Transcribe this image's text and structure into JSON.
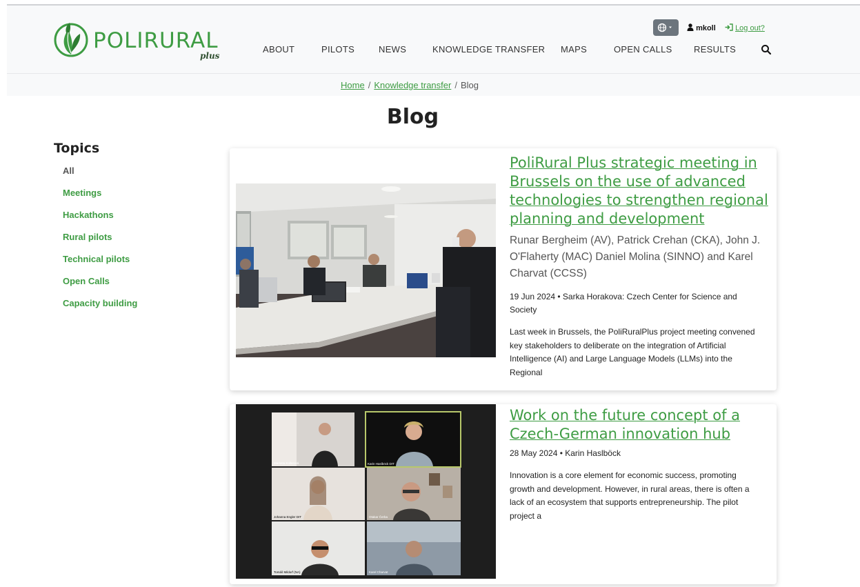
{
  "brand": {
    "name": "POLIRURAL",
    "suffix": "plus",
    "color": "#3e9c43"
  },
  "nav": {
    "items": [
      "ABOUT",
      "PILOTS",
      "NEWS",
      "KNOWLEDGE TRANSFER",
      "MAPS",
      "OPEN CALLS",
      "RESULTS"
    ],
    "search_icon": "search-icon",
    "language_icon": "globe-icon",
    "user_icon": "user-icon",
    "username": "mkoll",
    "logout_icon": "sign-out-icon",
    "logout": "Log out?"
  },
  "breadcrumb": {
    "home": "Home",
    "section": "Knowledge transfer",
    "current": "Blog",
    "separator": "/"
  },
  "page": {
    "title": "Blog"
  },
  "sidebar": {
    "title": "Topics",
    "items": [
      "All",
      "Meetings",
      "Hackathons",
      "Rural pilots",
      "Technical pilots",
      "Open Calls",
      "Capacity building"
    ]
  },
  "posts": [
    {
      "title_lines": [
        "PoliRural Plus strategic meeting in",
        "Brussels on the use of advanced",
        "technologies to strengthen regional",
        "planning and development"
      ],
      "authors_lines": [
        "Runar Bergheim (AV), Patrick Crehan (CKA), John J.",
        "O'Flaherty (MAC) Daniel Molina (SINNO) and Karel",
        "Charvat (CCSS)"
      ],
      "meta_lines": [
        "19 Jun 2024 • Sarka Horakova: Czech Center for Science and",
        "Society"
      ],
      "excerpt_lines": [
        "Last week in Brussels, the PoliRuralPlus project meeting convened",
        "key stakeholders to deliberate on the integration of Artificial",
        "Intelligence (AI) and Large Language Models (LLMs) into the",
        "Regional"
      ]
    },
    {
      "title_lines": [
        "Work on the future concept of a",
        "Czech-German innovation hub"
      ],
      "meta": "28 May 2024 • Karin Haslböck",
      "excerpt_lines": [
        "Innovation is a core element for economic success, promoting",
        "growth and development. However, in rural areas, there is often a",
        "lack of an ecosystem that supports entrepreneurship. The pilot",
        "project a"
      ],
      "participants": [
        "Marketa Kollerová",
        "Karin Haslböck DIT",
        "Johanna Engler DIT",
        "Otakar Čerba",
        "Tomáš Mildorf (NA)",
        "Karel Charvat"
      ]
    }
  ]
}
